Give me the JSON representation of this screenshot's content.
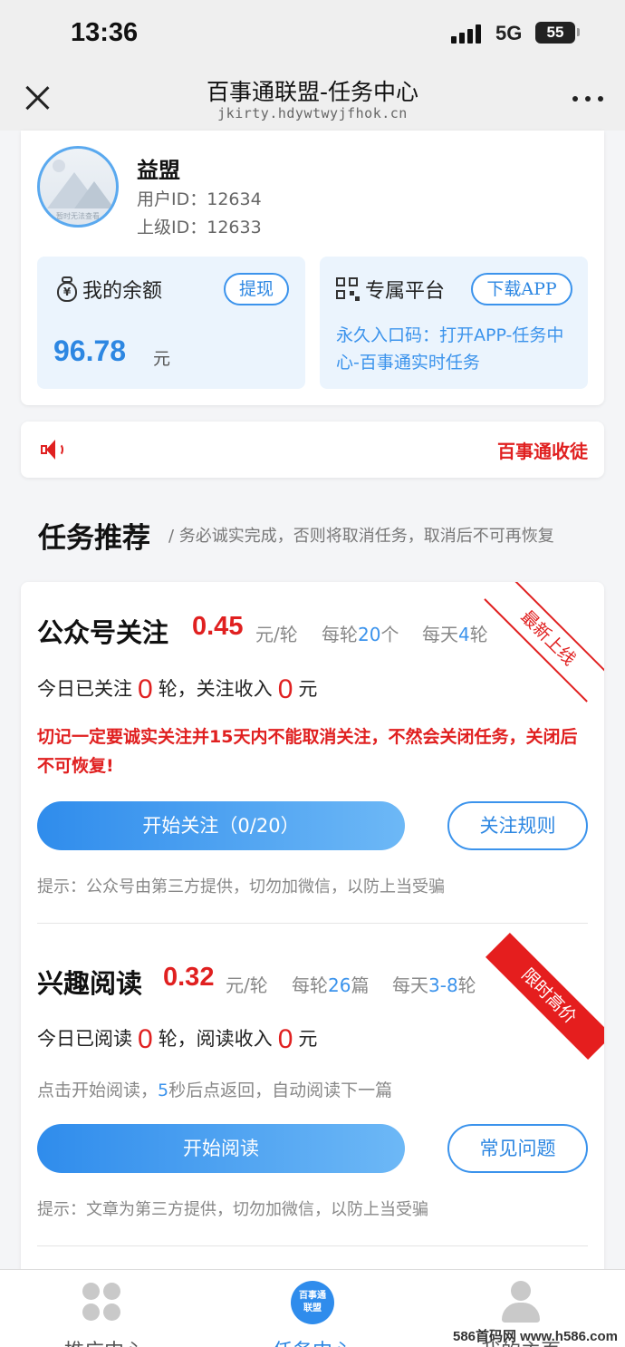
{
  "status_bar": {
    "time": "13:36",
    "network": "5G",
    "battery": "55"
  },
  "nav": {
    "title": "百事通联盟-任务中心",
    "url": "jkirty.hdywtwyjfhok.cn"
  },
  "profile": {
    "avatar_text": "暂时无法查看",
    "name": "益盟",
    "user_id": "用户ID：12634",
    "parent_id": "上级ID：12633"
  },
  "balance": {
    "label": "我的余额",
    "withdraw_label": "提现",
    "amount": "96.78",
    "unit": "元"
  },
  "platform": {
    "label": "专属平台",
    "download_label": "下载APP",
    "note": "永久入口码：打开APP-任务中心-百事通实时任务"
  },
  "notice": {
    "text": "百事通收徒"
  },
  "section": {
    "title": "任务推荐",
    "subtitle": "/ 务必诚实完成，否则将取消任务，取消后不可再恢复"
  },
  "tasks": [
    {
      "title": "公众号关注",
      "price": "0.45",
      "price_unit": "元/轮",
      "per_round_prefix": "每轮",
      "per_round_value": "20",
      "per_round_suffix": "个",
      "per_day_prefix": "每天",
      "per_day_value": "4",
      "per_day_suffix": "轮",
      "badge": "最新上线",
      "progress_prefix": "今日已关注",
      "progress_rounds": "0",
      "progress_mid": "轮，关注收入",
      "progress_income": "0",
      "progress_suffix": "元",
      "warning": "切记一定要诚实关注并15天内不能取消关注，不然会关闭任务，关闭后不可恢复!",
      "primary_button": "开始关注（0/20）",
      "secondary_button": "关注规则",
      "tip": "提示：公众号由第三方提供，切勿加微信，以防上当受骗"
    },
    {
      "title": "兴趣阅读",
      "price": "0.32",
      "price_unit": "元/轮",
      "per_round_prefix": "每轮",
      "per_round_value": "26",
      "per_round_suffix": "篇",
      "per_day_prefix": "每天",
      "per_day_value": "3-8",
      "per_day_suffix": "轮",
      "badge": "限时高价",
      "progress_prefix": "今日已阅读",
      "progress_rounds": "0",
      "progress_mid": "轮，阅读收入",
      "progress_income": "0",
      "progress_suffix": "元",
      "hint_prefix": "点击开始阅读，",
      "hint_value": "5",
      "hint_suffix": "秒后点返回，自动阅读下一篇",
      "primary_button": "开始阅读",
      "secondary_button": "常见问题",
      "tip": "提示：文章为第三方提供，切勿加微信，以防上当受骗"
    }
  ],
  "tab_bar": {
    "items": [
      {
        "label": "推广中心"
      },
      {
        "label": "任务中心",
        "logo_text_1": "百事通",
        "logo_text_2": "联盟"
      },
      {
        "label": "我的主页"
      }
    ]
  },
  "watermark": "586首码网 www.h586.com",
  "colors": {
    "accent": "#2d87e2",
    "alert": "#e02020",
    "panel": "#ebf4fd"
  }
}
